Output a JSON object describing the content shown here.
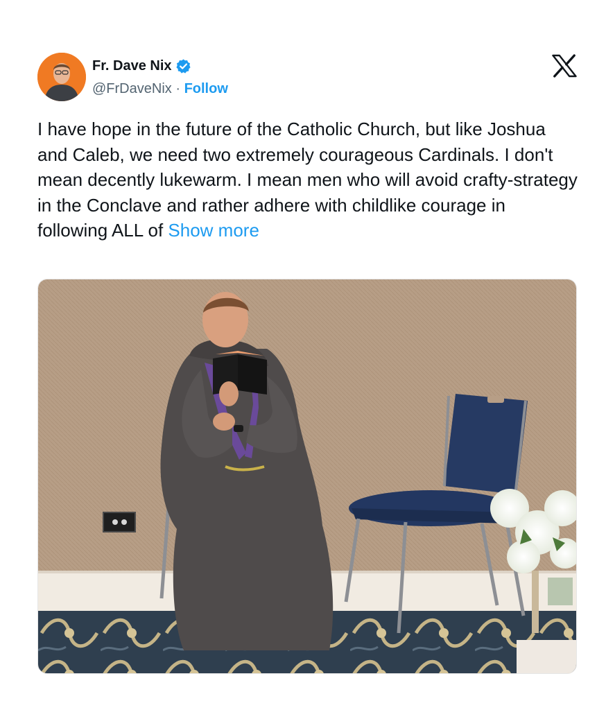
{
  "author": {
    "name": "Fr. Dave Nix",
    "handle": "@FrDaveNix",
    "separator": "·",
    "follow_label": "Follow",
    "verified": true,
    "avatar_icon": "avatar-portrait"
  },
  "platform": {
    "logo_icon": "x-logo-icon"
  },
  "tweet": {
    "text": "I have hope in the future of the Catholic Church, but like Joshua and Caleb, we need two extremely courageous Cardinals.  I don't mean decently lukewarm.  I mean men who will avoid crafty-strategy in the Conclave and rather adhere with childlike courage in following ALL of",
    "show_more_label": "Show more"
  },
  "media": {
    "type": "photo"
  },
  "colors": {
    "accent": "#1d9bf0",
    "text": "#0f1419",
    "secondary_text": "#536471",
    "avatar_bg": "#f07a23"
  }
}
